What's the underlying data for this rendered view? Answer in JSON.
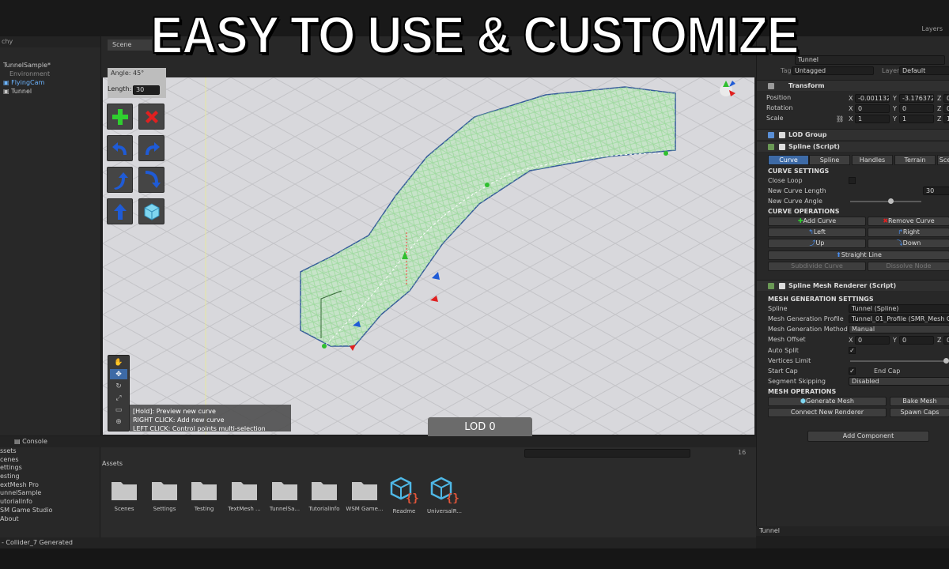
{
  "headline": "EASY TO USE & CUSTOMIZE",
  "toolbar": {
    "layers": "Layers",
    "tag_label": "Tag",
    "tag_value": "Untagged",
    "layer_label": "Layer",
    "layer_value": "Default"
  },
  "hierarchy": {
    "tab": "chy",
    "items": [
      {
        "label": "TunnelSample*",
        "selected": false
      },
      {
        "label": "Environment",
        "selected": false
      },
      {
        "label": "FlyingCam",
        "selected": true
      },
      {
        "label": "Tunnel",
        "selected": false
      }
    ]
  },
  "scene": {
    "tab": "Scene",
    "angle_label": "Angle: 45°",
    "length_label": "Length:",
    "length_value": "30",
    "lod_label": "LOD 0",
    "hints": [
      "[Hold]:   Preview new curve",
      "RIGHT CLICK:   Add new curve",
      "LEFT CLICK:   Control points multi-selection"
    ],
    "tool_buttons": [
      "add-curve",
      "remove-curve",
      "left",
      "right",
      "up",
      "down",
      "straight",
      "generate-mesh"
    ]
  },
  "inspector": {
    "object_name": "Tunnel",
    "transform": {
      "title": "Transform",
      "position": {
        "label": "Position",
        "x": "-0.001132",
        "y": "-3.176372",
        "z": "0"
      },
      "rotation": {
        "label": "Rotation",
        "x": "0",
        "y": "0",
        "z": "0"
      },
      "scale": {
        "label": "Scale",
        "x": "1",
        "y": "1",
        "z": "1"
      }
    },
    "lod_group": "LOD Group",
    "spline": {
      "title": "Spline (Script)",
      "tabs": [
        "Curve",
        "Spline",
        "Handles",
        "Terrain",
        "Sce"
      ],
      "curve_settings": "CURVE SETTINGS",
      "close_loop": "Close Loop",
      "new_curve_length": "New Curve Length",
      "new_curve_length_value": "30",
      "new_curve_angle": "New Curve Angle",
      "curve_operations": "CURVE OPERATIONS",
      "add_curve": "Add Curve",
      "remove_curve": "Remove Curve",
      "left": "Left",
      "right": "Right",
      "up": "Up",
      "down": "Down",
      "straight_line": "Straight Line",
      "subdivide_curve": "Subdivide Curve",
      "dissolve_node": "Dissolve Node"
    },
    "mesh_renderer": {
      "title": "Spline Mesh Renderer (Script)",
      "settings": "MESH GENERATION SETTINGS",
      "spline_label": "Spline",
      "spline_value": "Tunnel (Spline)",
      "profile_label": "Mesh Generation Profile",
      "profile_value": "Tunnel_01_Profile (SMR_Mesh G",
      "method_label": "Mesh Generation Method",
      "method_value": "Manual",
      "offset_label": "Mesh Offset",
      "offset_x": "0",
      "offset_y": "0",
      "offset_z": "0",
      "auto_split": "Auto Split",
      "vertices_limit": "Vertices Limit",
      "start_cap": "Start Cap",
      "end_cap": "End Cap",
      "segment_skipping": "Segment Skipping",
      "segment_skipping_value": "Disabled",
      "operations": "MESH OPERATIONS",
      "generate_mesh": "Generate Mesh",
      "bake_mesh": "Bake Mesh",
      "connect_new_renderer": "Connect New Renderer",
      "spawn_caps": "Spawn Caps"
    },
    "add_component": "Add Component",
    "footer": "Tunnel"
  },
  "project": {
    "tabs": [
      "Console"
    ],
    "tree": [
      "ssets",
      "cenes",
      "ettings",
      "esting",
      "extMesh Pro",
      "unnelSample",
      "utorialInfo",
      "SM Game Studio",
      "About"
    ],
    "assets_title": "Assets",
    "count": "16",
    "assets": [
      {
        "label": "Scenes",
        "kind": "folder"
      },
      {
        "label": "Settings",
        "kind": "folder"
      },
      {
        "label": "Testing",
        "kind": "folder"
      },
      {
        "label": "TextMesh ...",
        "kind": "folder"
      },
      {
        "label": "TunnelSa...",
        "kind": "folder"
      },
      {
        "label": "TutorialInfo",
        "kind": "folder"
      },
      {
        "label": "WSM Game...",
        "kind": "folder"
      },
      {
        "label": "Readme",
        "kind": "cube"
      },
      {
        "label": "UniversalR...",
        "kind": "cube"
      }
    ],
    "status": "- Collider_7 Generated"
  },
  "colors": {
    "accent_blue": "#3d6aa6",
    "scene_bg": "#d8d8dc",
    "mesh_green": "#8fe08f",
    "arrow_blue": "#1f5bd6"
  }
}
